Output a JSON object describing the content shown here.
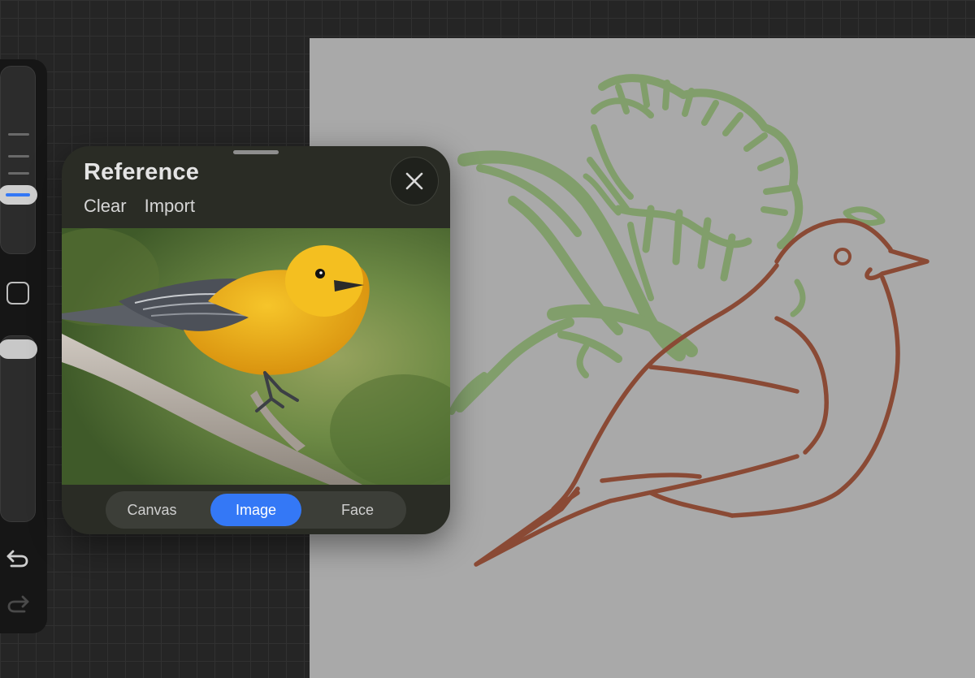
{
  "reference_panel": {
    "title": "Reference",
    "actions": [
      "Clear",
      "Import"
    ],
    "close_icon": "close-icon",
    "modes": [
      "Canvas",
      "Image",
      "Face"
    ],
    "selected_mode": "Image"
  },
  "sidebar": {
    "brush_size_level": 0.35,
    "opacity_level": 0.92,
    "icons": {
      "modify": "square-icon",
      "undo": "undo-arrow-icon",
      "redo": "redo-arrow-icon"
    }
  },
  "colors": {
    "accent": "#3478f6",
    "canvas": "#a9a9a9",
    "sketch_green": "#7e9e66",
    "sketch_brown": "#8a4a35"
  }
}
